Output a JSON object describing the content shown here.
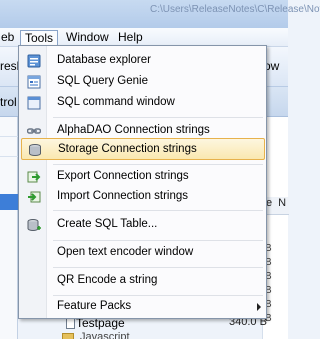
{
  "window": {
    "title_path": "C:\\Users\\ReleaseNotes\\C\\Release\\Notes\\"
  },
  "menubar": {
    "items": [
      {
        "label": "eb"
      },
      {
        "label": "Tools"
      },
      {
        "label": "Window"
      },
      {
        "label": "Help"
      }
    ]
  },
  "toolbar": {
    "left_text": "resh",
    "right_text": "ow"
  },
  "subtoolbar": {
    "left_text": "trol"
  },
  "right_column": {
    "header_1": "e",
    "header_2": "N",
    "values": [
      "B",
      "B",
      "B",
      "B",
      "B",
      "B",
      "B",
      "B",
      "B"
    ]
  },
  "tools_menu": {
    "items": [
      {
        "label": "Database explorer",
        "icon": "database-explorer-icon"
      },
      {
        "label": "SQL Query Genie",
        "icon": "sql-query-genie-icon"
      },
      {
        "label": "SQL command window",
        "icon": "sql-command-window-icon"
      },
      {
        "label": "AlphaDAO Connection strings",
        "icon": "connection-chain-icon"
      },
      {
        "label": "Storage Connection strings",
        "icon": "storage-disk-icon"
      },
      {
        "label": "Export Connection strings",
        "icon": "export-arrow-icon"
      },
      {
        "label": "Import Connection strings",
        "icon": "import-arrow-icon"
      },
      {
        "label": "Create SQL Table...",
        "icon": "create-table-icon"
      },
      {
        "label": "Open text encoder window",
        "icon": ""
      },
      {
        "label": "QR Encode a string",
        "icon": ""
      },
      {
        "label": "Feature Packs",
        "icon": ""
      }
    ]
  },
  "tree": {
    "item_label": "Testpage",
    "item_size": "340.0 B",
    "next_item_label": "Javascript"
  },
  "colors": {
    "highlight_border": "#e7b24c",
    "highlight_fill": "#fae8b0",
    "selection_strip": "#3d7ed8"
  }
}
